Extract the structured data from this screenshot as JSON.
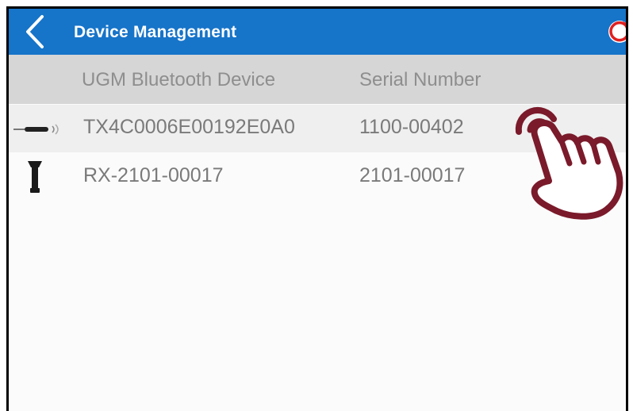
{
  "header": {
    "back_icon": "chevron-left-icon",
    "title": "Device Management",
    "refresh_icon": "refresh-icon",
    "background": "#1674c9"
  },
  "table": {
    "columns": [
      "UGM Bluetooth Device",
      "Serial Number"
    ],
    "rows": [
      {
        "device": "TX4C0006E00192E0A0",
        "serial": "1100-00402",
        "icon": "transmitter-icon"
      },
      {
        "device": "RX-2101-00017",
        "serial": "2101-00017",
        "icon": "receiver-icon"
      }
    ]
  },
  "overlay": {
    "icon": "tap-hand-icon",
    "color": "#7a1a2a"
  }
}
